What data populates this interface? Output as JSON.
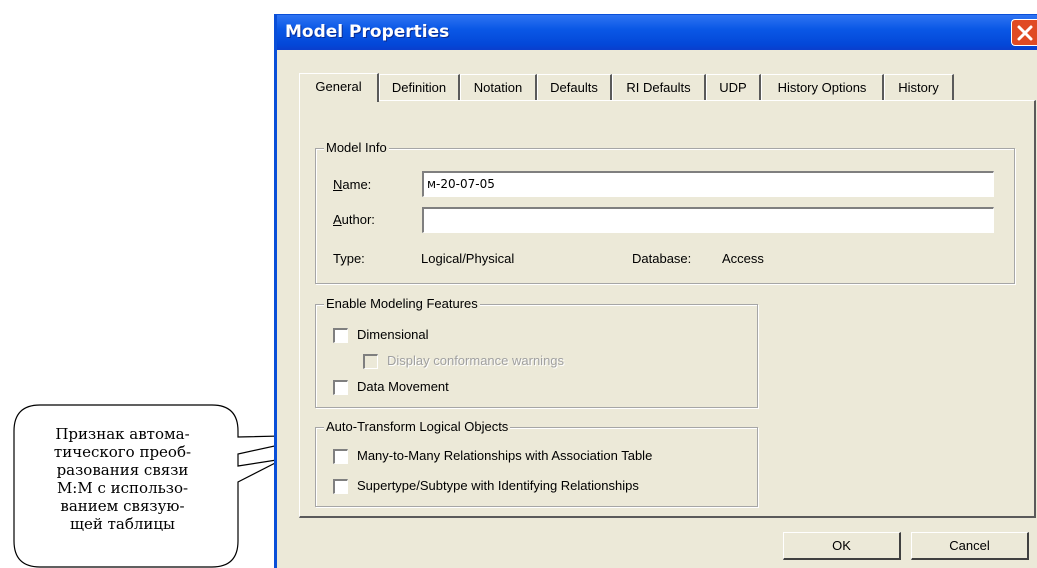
{
  "window": {
    "title": "Model Properties",
    "close_icon": "close-icon"
  },
  "tabs": [
    {
      "label": "General",
      "active": true
    },
    {
      "label": "Definition",
      "active": false
    },
    {
      "label": "Notation",
      "active": false
    },
    {
      "label": "Defaults",
      "active": false
    },
    {
      "label": "RI Defaults",
      "active": false
    },
    {
      "label": "UDP",
      "active": false
    },
    {
      "label": "History Options",
      "active": false
    },
    {
      "label": "History",
      "active": false
    }
  ],
  "model_info": {
    "legend": "Model Info",
    "name_label_prefix": "N",
    "name_label_rest": "ame:",
    "name_value": "м-20-07-05",
    "author_label_prefix": "A",
    "author_label_rest": "uthor:",
    "author_value": "",
    "type_label": "Type:",
    "type_value": "Logical/Physical",
    "database_label": "Database:",
    "database_value": "Access"
  },
  "modeling_features": {
    "legend": "Enable Modeling Features",
    "dimensional": {
      "label": "Dimensional",
      "checked": false
    },
    "display_warnings": {
      "label": "Display conformance warnings",
      "checked": false,
      "enabled": false
    },
    "data_movement": {
      "label": "Data Movement",
      "checked": false
    }
  },
  "auto_transform": {
    "legend": "Auto-Transform Logical Objects",
    "many_to_many": {
      "label": "Many-to-Many Relationships with Association Table",
      "checked": false
    },
    "supertype": {
      "label": "Supertype/Subtype with Identifying Relationships",
      "checked": false
    }
  },
  "buttons": {
    "ok": "OK",
    "cancel": "Cancel"
  },
  "callout": {
    "lines": [
      "Признак автома-",
      "тического преоб-",
      "разования связи",
      "М:М с использо-",
      "ванием связую-",
      "щей таблицы"
    ]
  },
  "colors": {
    "titlebar": "#0a58e6",
    "dialog_bg": "#ece9d8",
    "close_button": "#e04a24"
  }
}
